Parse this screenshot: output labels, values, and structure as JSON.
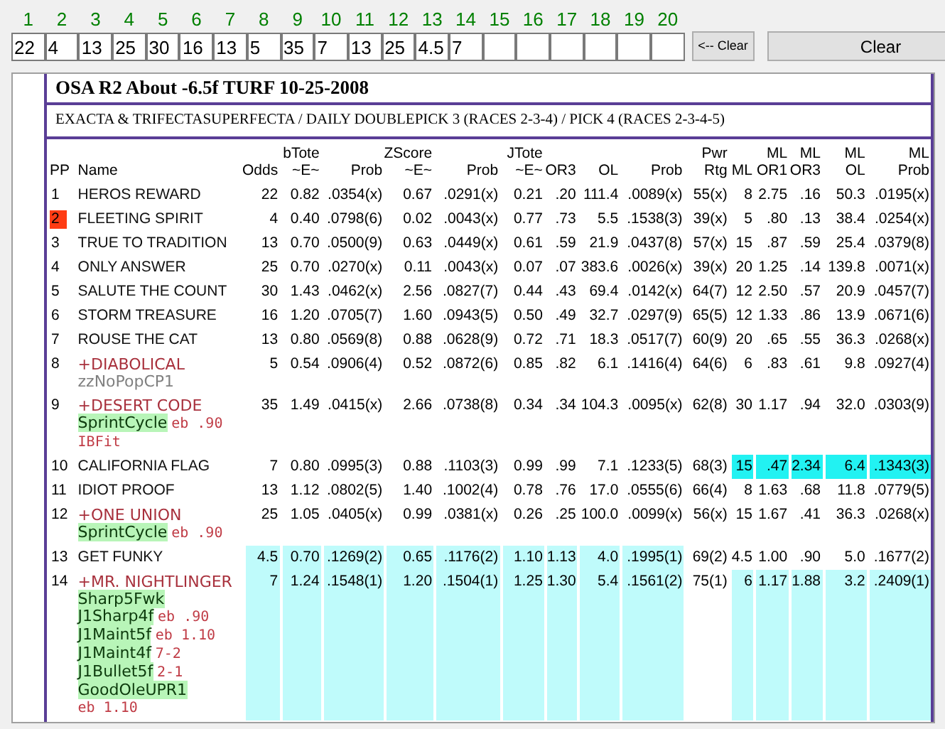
{
  "race_inputs": [
    {
      "number": "1",
      "value": "22"
    },
    {
      "number": "2",
      "value": "4"
    },
    {
      "number": "3",
      "value": "13"
    },
    {
      "number": "4",
      "value": "25"
    },
    {
      "number": "5",
      "value": "30"
    },
    {
      "number": "6",
      "value": "16"
    },
    {
      "number": "7",
      "value": "13"
    },
    {
      "number": "8",
      "value": "5"
    },
    {
      "number": "9",
      "value": "35"
    },
    {
      "number": "10",
      "value": "7"
    },
    {
      "number": "11",
      "value": "13"
    },
    {
      "number": "12",
      "value": "25"
    },
    {
      "number": "13",
      "value": "4.5"
    },
    {
      "number": "14",
      "value": "7"
    },
    {
      "number": "15"
    },
    {
      "number": "16"
    },
    {
      "number": "17"
    },
    {
      "number": "18"
    },
    {
      "number": "19"
    },
    {
      "number": "20"
    }
  ],
  "buttons": [
    {
      "label": "<-- Clear",
      "kind": "small"
    },
    {
      "label": "Clear",
      "kind": "wide"
    }
  ],
  "report": {
    "title": "OSA R2 About -6.5f TURF 10-25-2008",
    "subtitle": "EXACTA & TRIFECTASUPERFECTA / DAILY DOUBLEPICK 3 (RACES 2-3-4) / PICK 4 (RACES 2-3-4-5)",
    "columns": {
      "pp": "PP",
      "name": "Name",
      "values": [
        "Odds",
        "bTote\n~E~",
        "Prob",
        "ZScore\n~E~",
        "Prob",
        "JTote\n~E~",
        "OR3",
        "OL",
        "Prob",
        "Pwr\nRtg",
        "ML",
        "ML\nOR1",
        "ML\nOR3",
        "ML\nOL",
        "ML\nProb"
      ]
    },
    "rows": [
      {
        "pp": "1",
        "pp_marked": false,
        "name": "HEROS REWARD",
        "flagged": false,
        "cells": [
          {
            "text": "22"
          },
          {
            "text": "0.82"
          },
          {
            "text": ".0354(x)"
          },
          {
            "text": "0.67"
          },
          {
            "text": ".0291(x)"
          },
          {
            "text": "0.21"
          },
          {
            "text": ".20"
          },
          {
            "text": "111.4"
          },
          {
            "text": ".0089(x)"
          },
          {
            "text": "55(x)"
          },
          {
            "text": "8"
          },
          {
            "text": "2.75"
          },
          {
            "text": ".16"
          },
          {
            "text": "50.3"
          },
          {
            "text": ".0195(x)"
          }
        ]
      },
      {
        "pp": "2",
        "pp_marked": true,
        "name": "FLEETING SPIRIT",
        "flagged": false,
        "cells": [
          {
            "text": "4"
          },
          {
            "text": "0.40"
          },
          {
            "text": ".0798(6)"
          },
          {
            "text": "0.02"
          },
          {
            "text": ".0043(x)"
          },
          {
            "text": "0.77"
          },
          {
            "text": ".73"
          },
          {
            "text": "5.5"
          },
          {
            "text": ".1538(3)"
          },
          {
            "text": "39(x)"
          },
          {
            "text": "5"
          },
          {
            "text": ".80"
          },
          {
            "text": ".13"
          },
          {
            "text": "38.4"
          },
          {
            "text": ".0254(x)"
          }
        ]
      },
      {
        "pp": "3",
        "pp_marked": false,
        "name": "TRUE TO TRADITION",
        "flagged": false,
        "cells": [
          {
            "text": "13"
          },
          {
            "text": "0.70"
          },
          {
            "text": ".0500(9)"
          },
          {
            "text": "0.63"
          },
          {
            "text": ".0449(x)"
          },
          {
            "text": "0.61"
          },
          {
            "text": ".59"
          },
          {
            "text": "21.9"
          },
          {
            "text": ".0437(8)"
          },
          {
            "text": "57(x)"
          },
          {
            "text": "15"
          },
          {
            "text": ".87"
          },
          {
            "text": ".59"
          },
          {
            "text": "25.4"
          },
          {
            "text": ".0379(8)"
          }
        ]
      },
      {
        "pp": "4",
        "pp_marked": false,
        "name": "ONLY ANSWER",
        "flagged": false,
        "cells": [
          {
            "text": "25"
          },
          {
            "text": "0.70"
          },
          {
            "text": ".0270(x)"
          },
          {
            "text": "0.11"
          },
          {
            "text": ".0043(x)"
          },
          {
            "text": "0.07"
          },
          {
            "text": ".07"
          },
          {
            "text": "383.6"
          },
          {
            "text": ".0026(x)"
          },
          {
            "text": "39(x)"
          },
          {
            "text": "20"
          },
          {
            "text": "1.25"
          },
          {
            "text": ".14"
          },
          {
            "text": "139.8"
          },
          {
            "text": ".0071(x)"
          }
        ]
      },
      {
        "pp": "5",
        "pp_marked": false,
        "name": "SALUTE THE COUNT",
        "flagged": false,
        "cells": [
          {
            "text": "30"
          },
          {
            "text": "1.43"
          },
          {
            "text": ".0462(x)"
          },
          {
            "text": "2.56"
          },
          {
            "text": ".0827(7)"
          },
          {
            "text": "0.44"
          },
          {
            "text": ".43"
          },
          {
            "text": "69.4"
          },
          {
            "text": ".0142(x)"
          },
          {
            "text": "64(7)"
          },
          {
            "text": "12"
          },
          {
            "text": "2.50"
          },
          {
            "text": ".57"
          },
          {
            "text": "20.9"
          },
          {
            "text": ".0457(7)"
          }
        ]
      },
      {
        "pp": "6",
        "pp_marked": false,
        "name": "STORM TREASURE",
        "flagged": false,
        "cells": [
          {
            "text": "16"
          },
          {
            "text": "1.20"
          },
          {
            "text": ".0705(7)"
          },
          {
            "text": "1.60"
          },
          {
            "text": ".0943(5)"
          },
          {
            "text": "0.50"
          },
          {
            "text": ".49"
          },
          {
            "text": "32.7"
          },
          {
            "text": ".0297(9)"
          },
          {
            "text": "65(5)"
          },
          {
            "text": "12"
          },
          {
            "text": "1.33"
          },
          {
            "text": ".86"
          },
          {
            "text": "13.9"
          },
          {
            "text": ".0671(6)"
          }
        ]
      },
      {
        "pp": "7",
        "pp_marked": false,
        "name": "ROUSE THE CAT",
        "flagged": false,
        "cells": [
          {
            "text": "13"
          },
          {
            "text": "0.80"
          },
          {
            "text": ".0569(8)"
          },
          {
            "text": "0.88"
          },
          {
            "text": ".0628(9)"
          },
          {
            "text": "0.72"
          },
          {
            "text": ".71"
          },
          {
            "text": "18.3"
          },
          {
            "text": ".0517(7)"
          },
          {
            "text": "60(9)"
          },
          {
            "text": "20"
          },
          {
            "text": ".65"
          },
          {
            "text": ".55"
          },
          {
            "text": "36.3"
          },
          {
            "text": ".0268(x)"
          }
        ]
      },
      {
        "pp": "8",
        "pp_marked": false,
        "name": "+DIABOLICAL",
        "flagged": true,
        "notes": [
          {
            "text": "zzNoPopCP1",
            "kind": "muted"
          }
        ],
        "cells": [
          {
            "text": "5"
          },
          {
            "text": "0.54"
          },
          {
            "text": ".0906(4)"
          },
          {
            "text": "0.52"
          },
          {
            "text": ".0872(6)"
          },
          {
            "text": "0.85"
          },
          {
            "text": ".82"
          },
          {
            "text": "6.1"
          },
          {
            "text": ".1416(4)"
          },
          {
            "text": "64(6)"
          },
          {
            "text": "6"
          },
          {
            "text": ".83"
          },
          {
            "text": ".61"
          },
          {
            "text": "9.8"
          },
          {
            "text": ".0927(4)"
          }
        ]
      },
      {
        "pp": "9",
        "pp_marked": false,
        "name": "+DESERT CODE",
        "flagged": true,
        "notes": [
          {
            "text": "SprintCycle",
            "kind": "tag",
            "suffix": "eb .90"
          },
          {
            "text": "IBFit",
            "kind": "code"
          }
        ],
        "cells": [
          {
            "text": "35"
          },
          {
            "text": "1.49"
          },
          {
            "text": ".0415(x)"
          },
          {
            "text": "2.66"
          },
          {
            "text": ".0738(8)"
          },
          {
            "text": "0.34"
          },
          {
            "text": ".34"
          },
          {
            "text": "104.3"
          },
          {
            "text": ".0095(x)"
          },
          {
            "text": "62(8)"
          },
          {
            "text": "30"
          },
          {
            "text": "1.17"
          },
          {
            "text": ".94"
          },
          {
            "text": "32.0"
          },
          {
            "text": ".0303(9)"
          }
        ]
      },
      {
        "pp": "10",
        "pp_marked": false,
        "name": "CALIFORNIA FLAG",
        "flagged": false,
        "cells": [
          {
            "text": "7"
          },
          {
            "text": "0.80"
          },
          {
            "text": ".0995(3)"
          },
          {
            "text": "0.88"
          },
          {
            "text": ".1103(3)"
          },
          {
            "text": "0.99"
          },
          {
            "text": ".99"
          },
          {
            "text": "7.1"
          },
          {
            "text": ".1233(5)"
          },
          {
            "text": "68(3)"
          },
          {
            "text": "15",
            "color": "#22f2f2"
          },
          {
            "text": ".47",
            "color": "#22f2f2"
          },
          {
            "text": "2.34",
            "color": "#22f2f2"
          },
          {
            "text": "6.4",
            "color": "#22f2f2"
          },
          {
            "text": ".1343(3)",
            "color": "#22f2f2"
          }
        ]
      },
      {
        "pp": "11",
        "pp_marked": false,
        "name": "IDIOT PROOF",
        "flagged": false,
        "cells": [
          {
            "text": "13"
          },
          {
            "text": "1.12"
          },
          {
            "text": ".0802(5)"
          },
          {
            "text": "1.40"
          },
          {
            "text": ".1002(4)"
          },
          {
            "text": "0.78"
          },
          {
            "text": ".76"
          },
          {
            "text": "17.0"
          },
          {
            "text": ".0555(6)"
          },
          {
            "text": "66(4)"
          },
          {
            "text": "8"
          },
          {
            "text": "1.63"
          },
          {
            "text": ".68"
          },
          {
            "text": "11.8"
          },
          {
            "text": ".0779(5)"
          }
        ]
      },
      {
        "pp": "12",
        "pp_marked": false,
        "name": "+ONE UNION",
        "flagged": true,
        "notes": [
          {
            "text": "SprintCycle",
            "kind": "tag",
            "suffix": "eb .90"
          }
        ],
        "cells": [
          {
            "text": "25"
          },
          {
            "text": "1.05"
          },
          {
            "text": ".0405(x)"
          },
          {
            "text": "0.99"
          },
          {
            "text": ".0381(x)"
          },
          {
            "text": "0.26"
          },
          {
            "text": ".25"
          },
          {
            "text": "100.0"
          },
          {
            "text": ".0099(x)"
          },
          {
            "text": "56(x)"
          },
          {
            "text": "15"
          },
          {
            "text": "1.67"
          },
          {
            "text": ".41"
          },
          {
            "text": "36.3"
          },
          {
            "text": ".0268(x)"
          }
        ]
      },
      {
        "pp": "13",
        "pp_marked": false,
        "name": "GET FUNKY",
        "flagged": false,
        "cells": [
          {
            "text": "4.5",
            "color": "#bffbfb"
          },
          {
            "text": "0.70",
            "color": "#bffbfb"
          },
          {
            "text": ".1269(2)",
            "color": "#bffbfb"
          },
          {
            "text": "0.65",
            "color": "#bffbfb"
          },
          {
            "text": ".1176(2)",
            "color": "#bffbfb"
          },
          {
            "text": "1.10",
            "color": "#bffbfb"
          },
          {
            "text": "1.13",
            "color": "#bffbfb"
          },
          {
            "text": "4.0",
            "color": "#bffbfb"
          },
          {
            "text": ".1995(1)",
            "color": "#bffbfb"
          },
          {
            "text": "69(2)"
          },
          {
            "text": "4.5"
          },
          {
            "text": "1.00"
          },
          {
            "text": ".90"
          },
          {
            "text": "5.0"
          },
          {
            "text": ".1677(2)"
          }
        ]
      },
      {
        "pp": "14",
        "pp_marked": false,
        "name": "+MR. NIGHTLINGER",
        "flagged": true,
        "notes": [
          {
            "text": "Sharp5Fwk",
            "kind": "tag"
          },
          {
            "text": "J1Sharp4f",
            "kind": "tag",
            "suffix": "eb .90"
          },
          {
            "text": "J1Maint5f",
            "kind": "tag",
            "suffix": "eb 1.10"
          },
          {
            "text": "J1Maint4f",
            "kind": "tag",
            "suffix": "7-2"
          },
          {
            "text": "J1Bullet5f",
            "kind": "tag",
            "suffix": "2-1"
          },
          {
            "text": "GoodOleUPR1",
            "kind": "tag",
            "suffix": "eb 1.10"
          }
        ],
        "cells": [
          {
            "text": "7",
            "color": "#bffbfb"
          },
          {
            "text": "1.24",
            "color": "#bffbfb"
          },
          {
            "text": ".1548(1)",
            "color": "#bffbfb"
          },
          {
            "text": "1.20",
            "color": "#bffbfb"
          },
          {
            "text": ".1504(1)",
            "color": "#bffbfb"
          },
          {
            "text": "1.25",
            "color": "#bffbfb"
          },
          {
            "text": "1.30",
            "color": "#bffbfb"
          },
          {
            "text": "5.4",
            "color": "#bffbfb"
          },
          {
            "text": ".1561(2)",
            "color": "#bffbfb"
          },
          {
            "text": "75(1)"
          },
          {
            "text": "6",
            "color": "#bffbfb"
          },
          {
            "text": "1.17",
            "color": "#bffbfb"
          },
          {
            "text": "1.88",
            "color": "#bffbfb"
          },
          {
            "text": "3.2",
            "color": "#bffbfb"
          },
          {
            "text": ".2409(1)",
            "color": "#bffbfb"
          }
        ]
      }
    ]
  }
}
